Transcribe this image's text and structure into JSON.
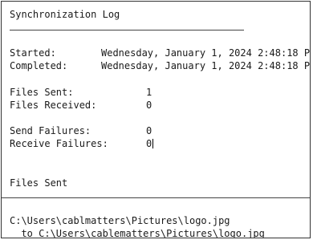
{
  "log": {
    "title": "Synchronization Log",
    "started_label": "Started:",
    "started_value": "Wednesday, January 1, 2024 2:48:18 PM",
    "completed_label": "Completed:",
    "completed_value": "Wednesday, January 1, 2024 2:48:18 PM",
    "files_sent_label": "Files Sent:",
    "files_sent_value": "1",
    "files_received_label": "Files Received:",
    "files_received_value": "0",
    "send_failures_label": "Send Failures:",
    "send_failures_value": "0",
    "receive_failures_label": "Receive Failures:",
    "receive_failures_value": "0",
    "files_sent_section": "Files Sent",
    "source_path": "C:\\Users\\cablmatters\\Pictures\\logo.jpg",
    "dest_path": "  to C:\\Users\\cablematters\\Pictures\\logo.jpg"
  }
}
